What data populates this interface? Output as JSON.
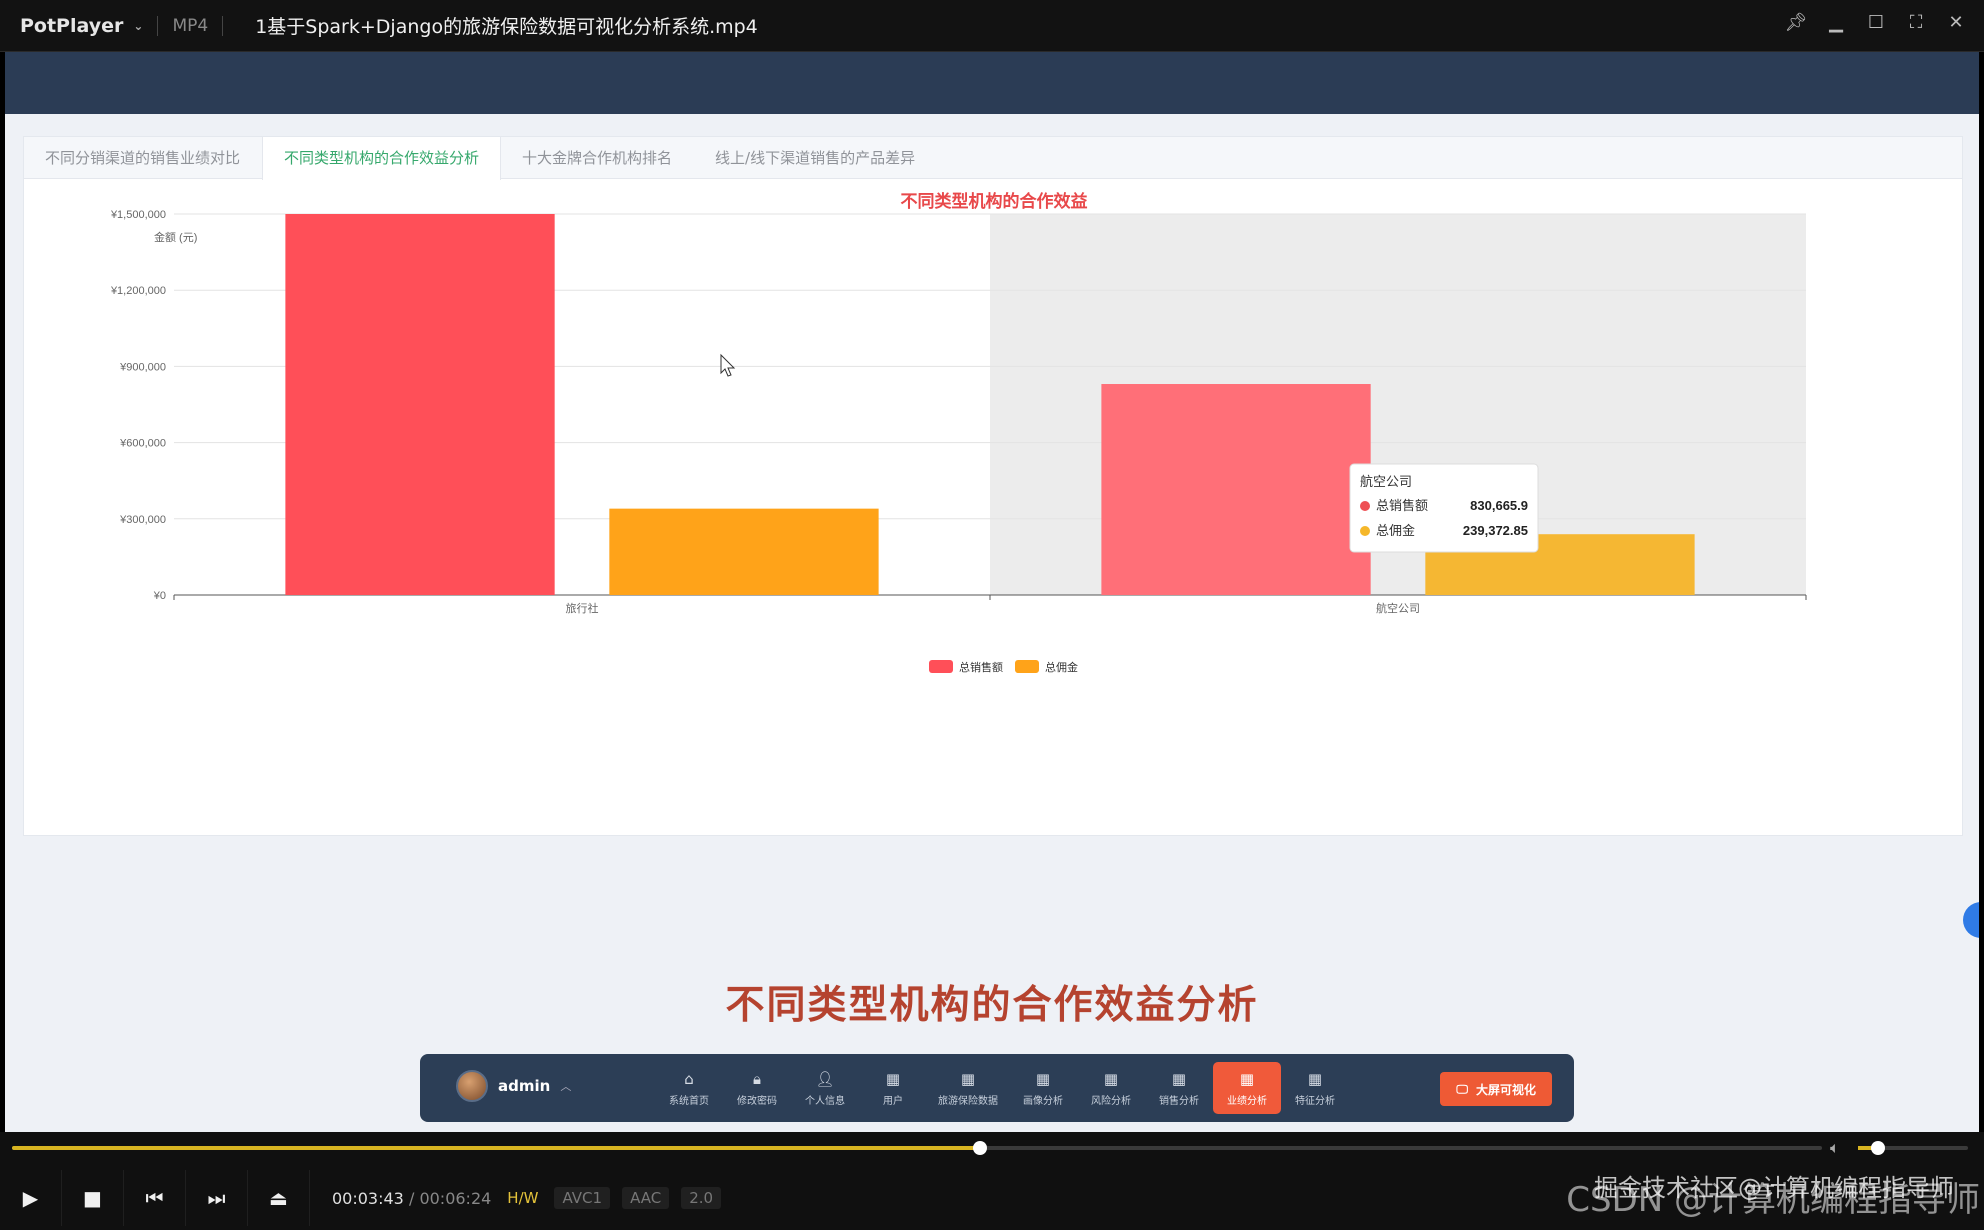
{
  "player": {
    "app_name": "PotPlayer",
    "format": "MP4",
    "file_title": "1基于Spark+Django的旅游保险数据可视化分析系统.mp4",
    "time_current": "00:03:43",
    "time_total": "00:06:24",
    "progress_fraction": 0.535,
    "volume_fraction": 0.18,
    "badges": [
      "H/W",
      "AVC1",
      "AAC",
      "2.0"
    ],
    "watermark_back": "CSDN @计算机编程指导师",
    "watermark_front": "掘金技术社区@计算机编程指导师"
  },
  "tabs": [
    {
      "label": "不同分销渠道的销售业绩对比",
      "active": false
    },
    {
      "label": "不同类型机构的合作效益分析",
      "active": true
    },
    {
      "label": "十大金牌合作机构排名",
      "active": false
    },
    {
      "label": "线上/线下渠道销售的产品差异",
      "active": false
    }
  ],
  "chart_data": {
    "type": "bar",
    "title": "不同类型机构的合作效益",
    "ylabel": "金额 (元)",
    "ylim": [
      0,
      1500000
    ],
    "yticks": [
      "¥0",
      "¥300,000",
      "¥600,000",
      "¥900,000",
      "¥1,200,000",
      "¥1,500,000"
    ],
    "categories": [
      "旅行社",
      "航空公司"
    ],
    "series": [
      {
        "name": "总销售额",
        "values": [
          1500000,
          830665.9
        ],
        "color": "#ff4f58"
      },
      {
        "name": "总佣金",
        "values": [
          340000,
          239372.85
        ],
        "color": "#ffa319"
      }
    ],
    "legend_position": "bottom-center",
    "hover_category_index": 1,
    "tooltip": {
      "title": "航空公司",
      "rows": [
        {
          "name": "总销售额",
          "value": "830,665.9",
          "color": "#ee5054"
        },
        {
          "name": "总佣金",
          "value": "239,372.85",
          "color": "#f5b72a"
        }
      ]
    }
  },
  "caption": "不同类型机构的合作效益分析",
  "appnav": {
    "username": "admin",
    "items": [
      {
        "label": "系统首页",
        "icon": "home-icon",
        "glyph": "⌂",
        "active": false
      },
      {
        "label": "修改密码",
        "icon": "lock-icon",
        "glyph": "🔒︎",
        "active": false
      },
      {
        "label": "个人信息",
        "icon": "person-icon",
        "glyph": "👤︎",
        "active": false
      },
      {
        "label": "用户",
        "icon": "grid-icon",
        "glyph": "▦",
        "active": false
      },
      {
        "label": "旅游保险数据",
        "icon": "grid-icon",
        "glyph": "▦",
        "active": false
      },
      {
        "label": "画像分析",
        "icon": "grid-icon",
        "glyph": "▦",
        "active": false
      },
      {
        "label": "风险分析",
        "icon": "grid-icon",
        "glyph": "▦",
        "active": false
      },
      {
        "label": "销售分析",
        "icon": "grid-icon",
        "glyph": "▦",
        "active": false
      },
      {
        "label": "业绩分析",
        "icon": "grid-icon",
        "glyph": "▦",
        "active": true
      },
      {
        "label": "特征分析",
        "icon": "grid-icon",
        "glyph": "▦",
        "active": false
      }
    ],
    "big_button": "大屏可视化"
  }
}
